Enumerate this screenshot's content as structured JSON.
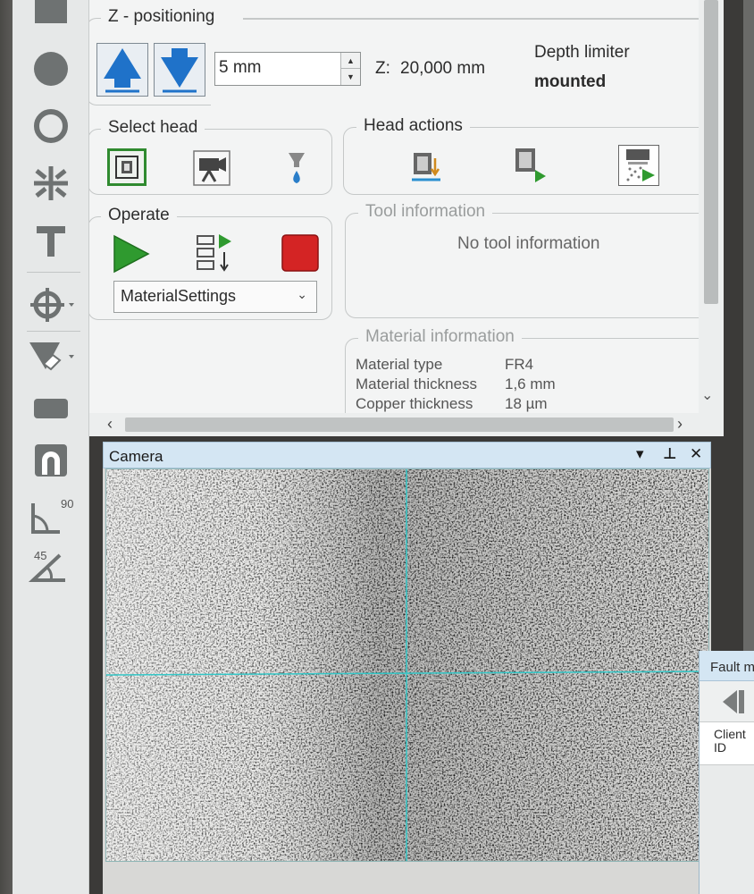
{
  "z_positioning": {
    "title": "Z - positioning",
    "step_value": "5 mm",
    "z_label": "Z:",
    "z_value": "20,000 mm",
    "depth_limiter_label": "Depth limiter",
    "depth_limiter_state": "mounted"
  },
  "select_head": {
    "title": "Select head"
  },
  "head_actions": {
    "title": "Head actions"
  },
  "operate": {
    "title": "Operate",
    "material_select": "MaterialSettings"
  },
  "tool_information": {
    "title": "Tool information",
    "message": "No tool information"
  },
  "material_information": {
    "title": "Material information",
    "rows": [
      {
        "label": "Material type",
        "value": "FR4"
      },
      {
        "label": "Material thickness",
        "value": "1,6 mm"
      },
      {
        "label": "Copper thickness",
        "value": "18 µm"
      }
    ]
  },
  "camera": {
    "title": "Camera"
  },
  "fault": {
    "title": "Fault m",
    "column": "Client ID"
  },
  "toolbar": {
    "angle_90": "90",
    "angle_45": "45"
  },
  "colors": {
    "arrow_blue": "#1f72c9",
    "run_green": "#2f9a2f",
    "stop_red": "#d42424",
    "crosshair": "#34c7c7"
  }
}
